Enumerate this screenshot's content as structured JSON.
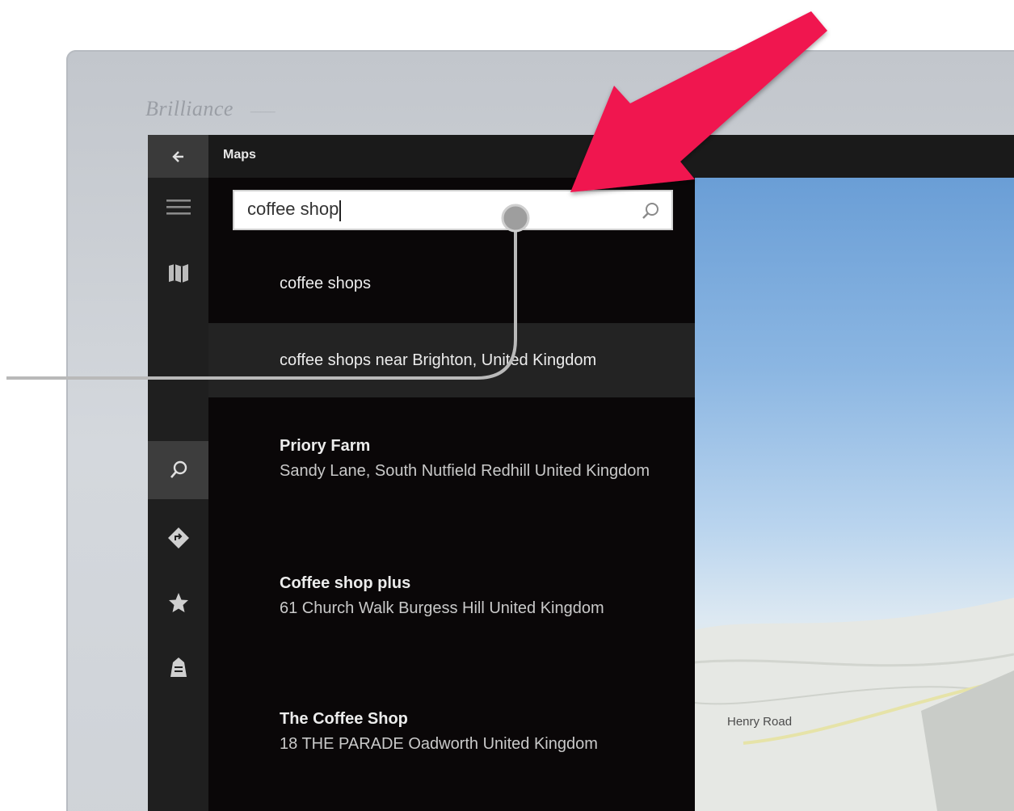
{
  "device": {
    "brand": "Brilliance",
    "brand_sub": "_____"
  },
  "app": {
    "title": "Maps"
  },
  "icons": {
    "back": "back-arrow-icon",
    "menu": "hamburger-menu-icon",
    "map": "map-icon",
    "search": "search-icon",
    "directions": "directions-icon",
    "favorites": "star-icon",
    "collections": "collections-icon"
  },
  "search": {
    "value": "coffee shop",
    "placeholder": ""
  },
  "suggestions": [
    {
      "label": "coffee shops"
    },
    {
      "label": "coffee shops near Brighton, United Kingdom"
    }
  ],
  "results": [
    {
      "name": "Priory Farm",
      "address": "Sandy Lane, South Nutfield Redhill United Kingdom"
    },
    {
      "name": "Coffee shop plus",
      "address": "61 Church Walk Burgess Hill United Kingdom"
    },
    {
      "name": "The Coffee Shop",
      "address": "18 THE PARADE Oadworth United Kingdom"
    }
  ],
  "map": {
    "road_label": "Henry Road"
  },
  "colors": {
    "annotation_arrow": "#f0134f",
    "pane_bg": "#0a0708",
    "rail_bg": "#1f1f1f"
  }
}
